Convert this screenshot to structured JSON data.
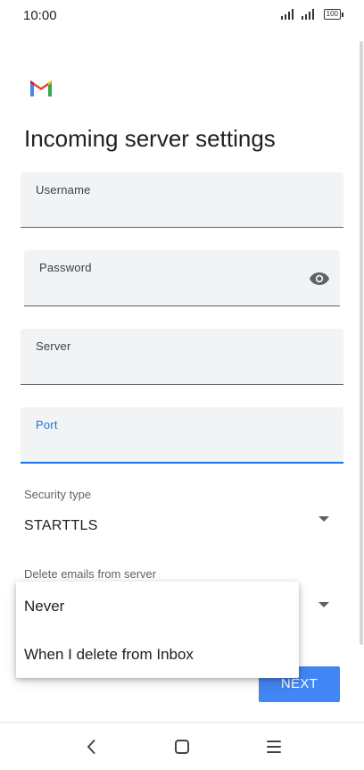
{
  "status_bar": {
    "time": "10:00",
    "battery": "100"
  },
  "title": "Incoming server settings",
  "fields": {
    "username": {
      "label": "Username",
      "value": ""
    },
    "password": {
      "label": "Password",
      "value": ""
    },
    "server": {
      "label": "Server",
      "value": ""
    },
    "port": {
      "label": "Port",
      "value": ""
    }
  },
  "security": {
    "label": "Security type",
    "value": "STARTTLS"
  },
  "delete_emails": {
    "label": "Delete emails from server"
  },
  "dropdown": {
    "options": [
      "Never",
      "When I delete from Inbox"
    ]
  },
  "next_label": "NEXT",
  "icons": {
    "logo": "gmail-icon",
    "password_toggle": "eye-icon",
    "nav": [
      "back-icon",
      "home-icon",
      "menu-icon"
    ]
  },
  "colors": {
    "accent": "#1a73e8",
    "button": "#4285f4",
    "field_bg": "#f1f3f4"
  }
}
